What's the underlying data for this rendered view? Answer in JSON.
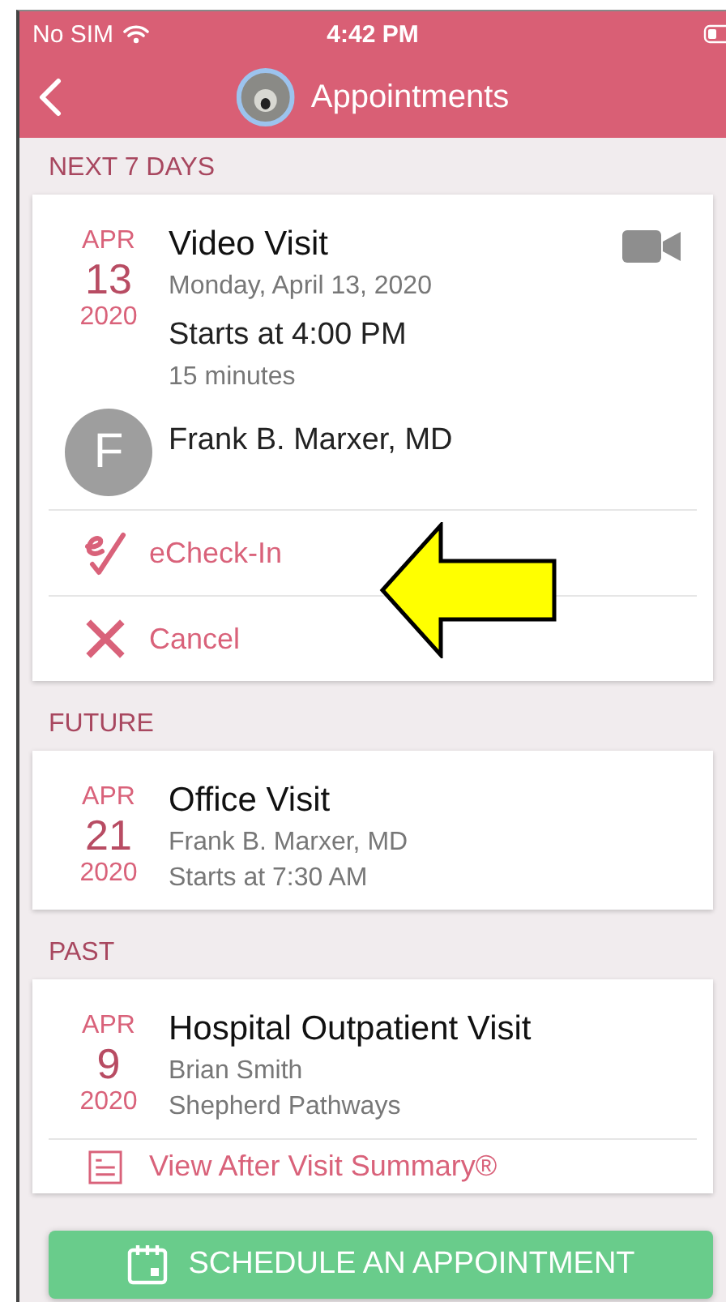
{
  "status_bar": {
    "carrier": "No SIM",
    "time": "4:42 PM"
  },
  "nav": {
    "title": "Appointments"
  },
  "sections": [
    {
      "heading": "NEXT 7 DAYS",
      "appointments": [
        {
          "month": "APR",
          "day": "13",
          "year": "2020",
          "title": "Video Visit",
          "video": true,
          "details": [
            {
              "kind": "small",
              "text": "Monday, April 13, 2020"
            },
            {
              "kind": "large",
              "text": "Starts at 4:00 PM"
            },
            {
              "kind": "small",
              "text": "15 minutes"
            }
          ],
          "provider": {
            "initial": "F",
            "name": "Frank B. Marxer, MD"
          },
          "actions": [
            {
              "kind": "echeckin",
              "label": "eCheck-In"
            },
            {
              "kind": "cancel",
              "label": "Cancel"
            }
          ]
        }
      ]
    },
    {
      "heading": "FUTURE",
      "appointments": [
        {
          "month": "APR",
          "day": "21",
          "year": "2020",
          "title": "Office Visit",
          "video": false,
          "details": [
            {
              "kind": "small",
              "text": "Frank B. Marxer, MD"
            },
            {
              "kind": "small",
              "text": "Starts at 7:30 AM"
            }
          ]
        }
      ]
    },
    {
      "heading": "PAST",
      "appointments": [
        {
          "month": "APR",
          "day": "9",
          "year": "2020",
          "title": "Hospital Outpatient Visit",
          "video": false,
          "details": [
            {
              "kind": "small",
              "text": "Brian Smith"
            },
            {
              "kind": "small",
              "text": "Shepherd Pathways"
            }
          ],
          "actions": [
            {
              "kind": "summary",
              "label": "View After Visit Summary®"
            }
          ]
        }
      ]
    }
  ],
  "schedule_button": {
    "label": "SCHEDULE AN APPOINTMENT"
  }
}
